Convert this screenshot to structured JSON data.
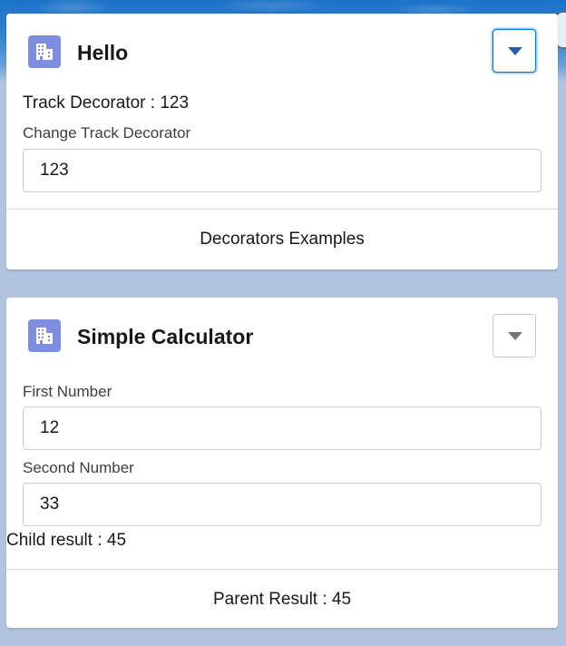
{
  "hello_card": {
    "title": "Hello",
    "icon": "building-icon",
    "track_decorator_text": "Track Decorator : 123",
    "change_label": "Change Track Decorator",
    "change_value": "123",
    "footer": "Decorators Examples"
  },
  "calculator_card": {
    "title": "Simple Calculator",
    "icon": "building-icon",
    "first_label": "First Number",
    "first_value": "12",
    "second_label": "Second Number",
    "second_value": "33",
    "child_result": "Child result : 45",
    "footer": "Parent Result : 45"
  },
  "colors": {
    "icon_background": "#7f8de1",
    "focus_border": "#0176d3",
    "page_background": "#b0c4df"
  }
}
